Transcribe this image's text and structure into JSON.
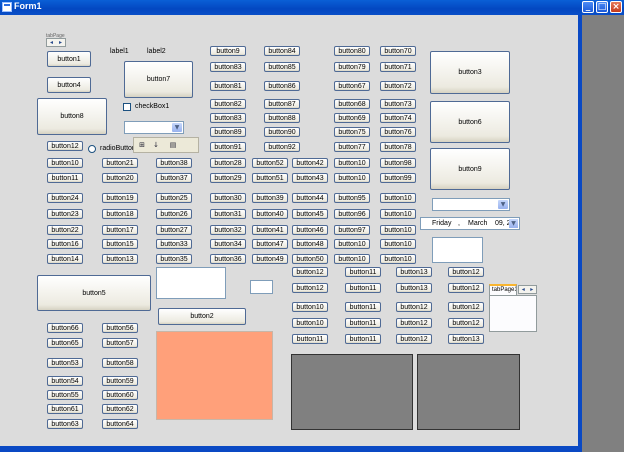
{
  "window": {
    "title": "Form1",
    "min_glyph": "_",
    "max_glyph": "□",
    "close_glyph": "×"
  },
  "labels": {
    "label1": "label1",
    "label2": "label2"
  },
  "checkbox": {
    "label": "checkBox1",
    "checked": false
  },
  "radio": {
    "label": "radioButton1",
    "checked": false
  },
  "tabstrip_small": {
    "header": "tabPage",
    "left": "◂",
    "right": "▸"
  },
  "tab_control": {
    "tab_label": "tabPage1",
    "left": "◂",
    "right": "▸"
  },
  "grid_toolbar": {
    "categorized": "⊞",
    "alphabetical": "↓",
    "pages": "▤"
  },
  "datetime": {
    "day": "Friday",
    "sep": ",",
    "month": "March",
    "rest": "09, 2",
    "arrow": "▼"
  },
  "combo_arrow": "▼",
  "buttons": {
    "b1": "button1",
    "b2": "button2",
    "b3": "button3",
    "b4": "button4",
    "b5": "button5",
    "b6": "button6",
    "b7": "button7",
    "b8": "button8",
    "b9": "button9",
    "b10": "button10",
    "b11": "button11",
    "b12": "button12",
    "b13": "button13",
    "b14": "button14",
    "b15": "button15",
    "b16": "button16",
    "b17": "button17",
    "b18": "button18",
    "b19": "button19",
    "b20": "button20",
    "b21": "button21",
    "b22": "button22",
    "b23": "button23",
    "b24": "button24",
    "b25": "button25",
    "b26": "button26",
    "b27": "button27",
    "b28": "button28",
    "b29": "button29",
    "b30": "button30",
    "b31": "button31",
    "b32": "button32",
    "b33": "button33",
    "b34": "button34",
    "b35": "button35",
    "b36": "button36",
    "b37": "button37",
    "b38": "button38",
    "b39": "button39",
    "b40": "button40",
    "b41": "button41",
    "b42": "button42",
    "b43": "button43",
    "b44": "button44",
    "b45": "button45",
    "b46": "button46",
    "b47": "button47",
    "b48": "button48",
    "b49": "button49",
    "b50": "button50",
    "b51": "button51",
    "b52": "button52",
    "b53": "button53",
    "b54": "button54",
    "b55": "button55",
    "b56": "button56",
    "b57": "button57",
    "b58": "button58",
    "b59": "button59",
    "b60": "button60",
    "b61": "button61",
    "b62": "button62",
    "b63": "button63",
    "b64": "button64",
    "b65": "button65",
    "b66": "button66",
    "b67": "button67",
    "b68": "button68",
    "b69": "button69",
    "b70": "button70",
    "b71": "button71",
    "b72": "button72",
    "b73": "button73",
    "b74": "button74",
    "b75": "button75",
    "b76": "button76",
    "b77": "button77",
    "b78": "button78",
    "b79": "button79",
    "b80": "button80",
    "b81": "button81",
    "b82": "button82",
    "b83": "button83",
    "b84": "button84",
    "b85": "button85",
    "b86": "button86",
    "b87": "button87",
    "b88": "button88",
    "b89": "button89",
    "b90": "button90",
    "b91": "button91",
    "b92": "button92",
    "b93": "button93",
    "b94": "button94",
    "b95": "button95",
    "b96": "button96",
    "b97": "button97",
    "b98": "button98",
    "b99": "button99"
  },
  "colors": {
    "panel_salmon": "#ffa07a",
    "panel_gray": "#808080",
    "title_blue": "#0a49c4"
  }
}
